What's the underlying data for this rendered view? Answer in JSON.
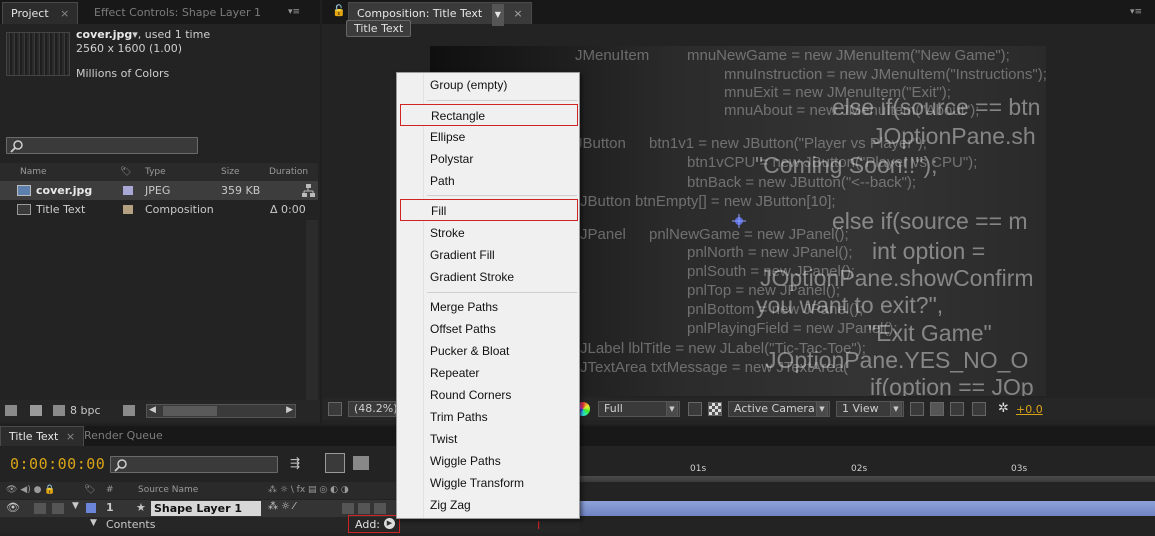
{
  "project_panel": {
    "tab_project": "Project",
    "tab_effect_controls": "Effect Controls: Shape Layer 1",
    "selected_item": {
      "name": "cover.jpg",
      "name_suffix": "▾",
      "usage": ", used 1 time",
      "dimensions": "2560 x 1600 (1.00)",
      "colors": "Millions of Colors"
    },
    "search_placeholder": "",
    "columns": {
      "name": "Name",
      "type": "Type",
      "size": "Size",
      "duration": "Duration"
    },
    "items": [
      {
        "name": "cover.jpg",
        "type": "JPEG",
        "size": "359 KB",
        "duration": "",
        "label_color": "#a9a7d6"
      },
      {
        "name": "Title Text",
        "type": "Composition",
        "size": "",
        "duration": "Δ 0:00",
        "label_color": "#b3a182"
      }
    ],
    "bpc": "8 bpc"
  },
  "composition_panel": {
    "title": "Composition: Title Text",
    "breadcrumb": "Title Text",
    "code_lines": [
      "JMenuItem",
      "mnuNewGame = new JMenuItem(\"New Game\");",
      "mnuInstruction = new JMenuItem(\"Instructions\");",
      "mnuExit = new JMenuItem(\"Exit\");",
      "mnuAbout = new JMenuItem(\"About\");",
      "else if(source == btn",
      "JOptionPane.sh",
      "JButton",
      "btn1v1 = new JButton(\"Player vs Player\");",
      "btn1vCPU = new JButton(\"Player vs CPU\");",
      "\"Coming Soon!!\");",
      "btnBack = new JButton(\"<--back\");",
      "JButton btnEmpty[] = new JButton[10];",
      "else if(source == m",
      "JPanel",
      "pnlNewGame = new JPanel();",
      "int option =",
      "pnlNorth = new JPanel();",
      "JOptionPane.showConfirm",
      "pnlSouth = new JPanel();",
      "pnlTop = new JPanel();",
      "you want to exit?\",",
      "pnlBottom = new JPanel();",
      "\"Exit Game\"",
      "pnlPlayingField = new JPanel();",
      "JLabel lblTitle = new JLabel(\"Tic-Tac-Toe\");",
      "JOptionPane.YES_NO_O",
      "JTextArea txtMessage = new JTextArea(",
      "if(option == JOp"
    ],
    "zoom": "(48.2%)",
    "resolution": "Full",
    "camera": "Active Camera",
    "view": "1 View",
    "exposure": "+0.0"
  },
  "timeline_panel": {
    "tab_title_text": "Title Text",
    "tab_render_queue": "Render Queue",
    "timecode": "0:00:00:00",
    "search_placeholder": "",
    "ruler_labels": [
      "01s",
      "02s",
      "03s"
    ],
    "column_source_name": "Source Name",
    "layer": {
      "number": "1",
      "name": "Shape Layer 1",
      "color": "#6b86d8"
    },
    "contents_label": "Contents",
    "add_label": "Add:"
  },
  "add_menu": {
    "items": [
      {
        "label": "Group (empty)",
        "highlighted": false
      },
      {
        "label": "Rectangle",
        "highlighted": true
      },
      {
        "label": "Ellipse",
        "highlighted": false
      },
      {
        "label": "Polystar",
        "highlighted": false
      },
      {
        "label": "Path",
        "highlighted": false
      },
      {
        "label": "Fill",
        "highlighted": true
      },
      {
        "label": "Stroke",
        "highlighted": false
      },
      {
        "label": "Gradient Fill",
        "highlighted": false
      },
      {
        "label": "Gradient Stroke",
        "highlighted": false
      },
      {
        "label": "Merge Paths",
        "highlighted": false
      },
      {
        "label": "Offset Paths",
        "highlighted": false
      },
      {
        "label": "Pucker & Bloat",
        "highlighted": false
      },
      {
        "label": "Repeater",
        "highlighted": false
      },
      {
        "label": "Round Corners",
        "highlighted": false
      },
      {
        "label": "Trim Paths",
        "highlighted": false
      },
      {
        "label": "Twist",
        "highlighted": false
      },
      {
        "label": "Wiggle Paths",
        "highlighted": false
      },
      {
        "label": "Wiggle Transform",
        "highlighted": false
      },
      {
        "label": "Zig Zag",
        "highlighted": false
      }
    ]
  },
  "colors": {
    "timecode": "#d9a317",
    "highlight_border": "#d02424",
    "track_bar": "#7f93cf"
  }
}
